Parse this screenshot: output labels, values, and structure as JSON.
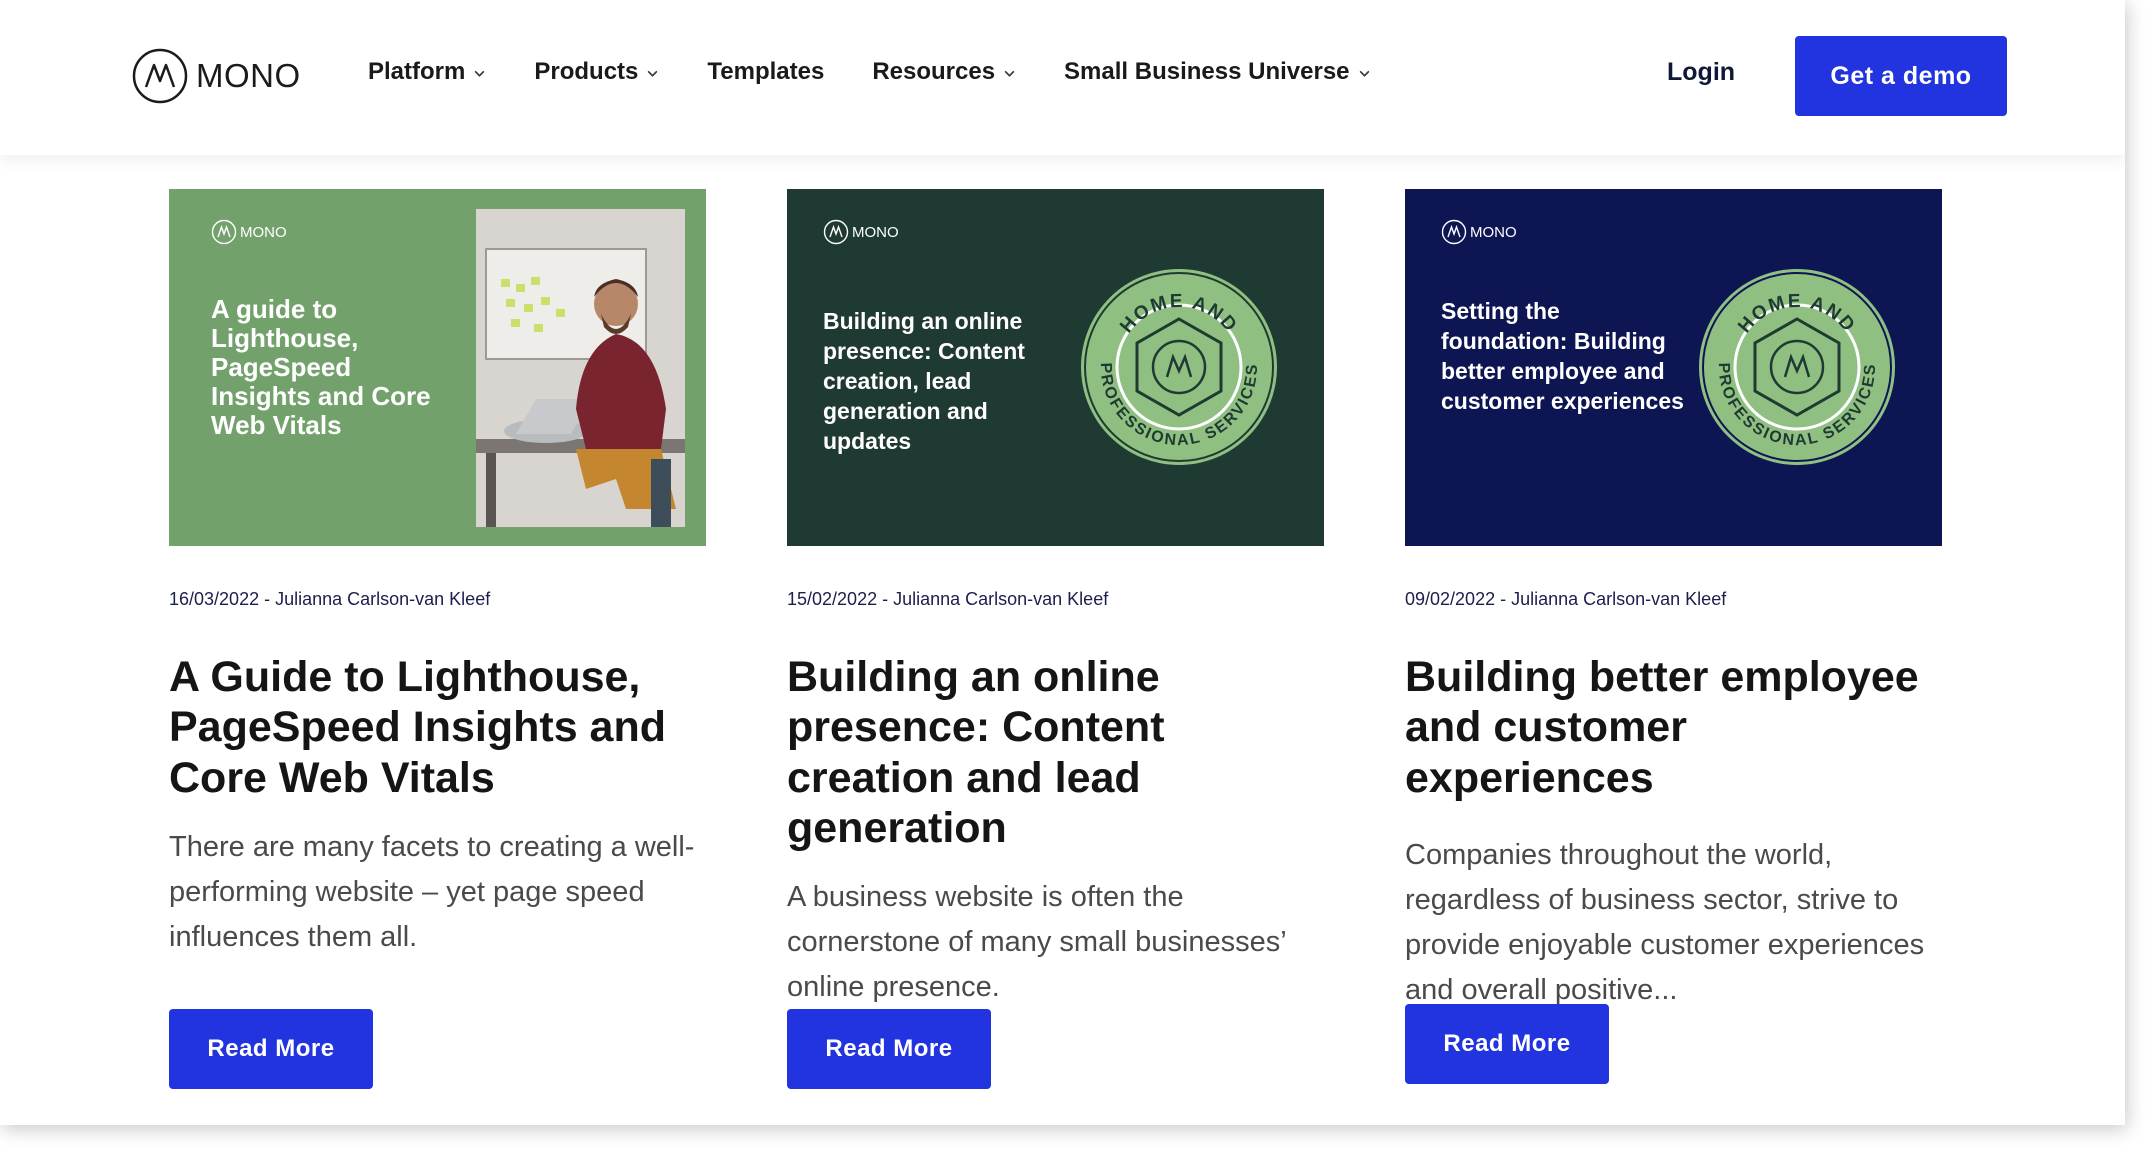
{
  "header": {
    "brand": "MONO",
    "nav": [
      {
        "label": "Platform",
        "dropdown": true
      },
      {
        "label": "Products",
        "dropdown": true
      },
      {
        "label": "Templates",
        "dropdown": false
      },
      {
        "label": "Resources",
        "dropdown": true
      },
      {
        "label": "Small Business Universe",
        "dropdown": true
      }
    ],
    "login": "Login",
    "cta": "Get a demo"
  },
  "colors": {
    "accent": "#2233e0",
    "card1_bg": "#73a16c",
    "card2_bg": "#1f3a32",
    "card3_bg": "#0e1553",
    "badge_green": "#8fc082"
  },
  "cards": [
    {
      "thumb_brand": "MONO",
      "thumb_text": "A guide to Lighthouse, PageSpeed Insights and Core Web Vitals",
      "meta": "16/03/2022 - Julianna Carlson-van Kleef",
      "title": "A Guide to Lighthouse, PageSpeed Insights and Core Web Vitals",
      "description": "There are many facets to creating a well-performing website – yet page speed influences them all.",
      "button": "Read More"
    },
    {
      "thumb_brand": "MONO",
      "thumb_text": "Building an online presence: Content creation, lead generation and updates",
      "badge_top": "HOME AND",
      "badge_bottom": "PROFESSIONAL SERVICES",
      "meta": "15/02/2022 - Julianna Carlson-van Kleef",
      "title": "Building an online presence: Content creation and lead generation",
      "description": "A business website is often the cornerstone of many small businesses’ online presence.",
      "button": "Read More"
    },
    {
      "thumb_brand": "MONO",
      "thumb_text": "Setting the foundation: Building better employee and customer experiences",
      "badge_top": "HOME AND",
      "badge_bottom": "PROFESSIONAL SERVICES",
      "meta": "09/02/2022 - Julianna Carlson-van Kleef",
      "title": "Building better employee and customer experiences",
      "description": "Companies throughout the world, regardless of business sector, strive to provide enjoyable customer experiences and overall positive...",
      "button": "Read More"
    }
  ]
}
